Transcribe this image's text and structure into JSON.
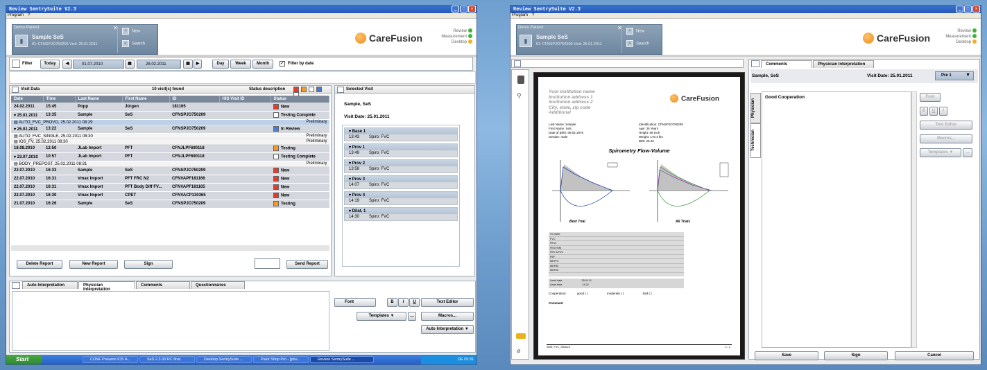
{
  "left_window": {
    "title": "Review SentrySuite V2.3",
    "menu": [
      "Program",
      "?"
    ],
    "patient": {
      "label": "Demo Patient",
      "name": "Sample SeS",
      "id_line": "ID: CFNSPJO750209 Visit: 25.01.2011",
      "new_label": "New",
      "search_label": "Search"
    },
    "brand": "CareFusion",
    "modes": [
      "Review",
      "Measurement",
      "Desktop"
    ],
    "filter": {
      "label": "Filter",
      "today": "Today",
      "from": "01.07.2010",
      "to": "28.02.2011",
      "day": "Day",
      "week": "Week",
      "month": "Month",
      "filter_by_date": "Filter by date"
    },
    "visit_data": {
      "title": "Visit Data",
      "found": "10 visit(s) found",
      "status_desc": "Status description",
      "columns": [
        "Date",
        "Time",
        "Last Name",
        "First Name",
        "ID",
        "HIS Visit ID",
        "Status"
      ],
      "rows": [
        {
          "date": "24.02.2011",
          "time": "15:45",
          "last": "Popp",
          "first": "Jürgen",
          "id": "181165",
          "status": "New",
          "st": "r"
        },
        {
          "date": "25.01.2011",
          "time": "13:35",
          "last": "Sample",
          "first": "SeS",
          "id": "CFNSPJO750209",
          "status": "Testing Complete",
          "st": "g",
          "exp": true
        },
        {
          "sub": "AUTO_FVC_PROVO, 25.02.2011 08:29",
          "right": "Preliminary",
          "sel": true
        },
        {
          "date": "25.01.2011",
          "time": "13:22",
          "last": "Sample",
          "first": "SeS",
          "id": "CFNSPJO750209",
          "status": "In Review",
          "st": "b",
          "exp": true
        },
        {
          "sub": "AUTO_FVC_SINGLE, 25.02.2011 08:30",
          "right": "Preliminary"
        },
        {
          "sub": "IOS_FV, 25.02.2011 08:30",
          "right": "Preliminary"
        },
        {
          "date": "18.08.2010",
          "time": "12:50",
          "last": "JLab Import",
          "first": "PFT",
          "id": "CFNJLPF690118",
          "status": "Testing",
          "st": "o"
        },
        {
          "date": "23.07.2010",
          "time": "10:57",
          "last": "JLab Import",
          "first": "PFT",
          "id": "CFNJLPF690118",
          "status": "Testing Complete",
          "st": "g",
          "exp": true
        },
        {
          "sub": "BODY_PREPOST, 25.02.2011 08:31",
          "right": "Preliminary"
        },
        {
          "date": "22.07.2010",
          "time": "16:33",
          "last": "Sample",
          "first": "SeS",
          "id": "CFNSPJO750209",
          "status": "New",
          "st": "r"
        },
        {
          "date": "22.07.2010",
          "time": "16:31",
          "last": "Vmax Import",
          "first": "PFT FRC N2",
          "id": "CFNVAPF181166",
          "status": "New",
          "st": "r"
        },
        {
          "date": "22.07.2010",
          "time": "16:31",
          "last": "Vmax Import",
          "first": "PFT Body Diff FV...",
          "id": "CFNVAPF181165",
          "status": "New",
          "st": "r"
        },
        {
          "date": "22.07.2010",
          "time": "16:30",
          "last": "Vmax Import",
          "first": "CPET",
          "id": "CFNVACP130365",
          "status": "New",
          "st": "r"
        },
        {
          "date": "21.07.2010",
          "time": "16:26",
          "last": "Sample",
          "first": "SeS",
          "id": "CFNSPJO750209",
          "status": "Testing",
          "st": "o"
        }
      ],
      "buttons": {
        "delete": "Delete Report",
        "new": "New Report",
        "sign": "Sign",
        "send": "Send Report"
      }
    },
    "selected_visit": {
      "title": "Selected Visit",
      "name": "Sample, SeS",
      "visit_date": "Visit Date: 25.01.2011",
      "groups": [
        {
          "h": "Base 1",
          "t": "13:43",
          "v": "Spiro: FVC"
        },
        {
          "h": "Prov 1",
          "t": "13:49",
          "v": "Spiro: FVC"
        },
        {
          "h": "Prov 2",
          "t": "13:58",
          "v": "Spiro: FVC"
        },
        {
          "h": "Prov 3",
          "t": "14:07",
          "v": "Spiro: FVC"
        },
        {
          "h": "Prov 4",
          "t": "14:19",
          "v": "Spiro: FVC"
        },
        {
          "h": "Dilat. 1",
          "t": "14:30",
          "v": "Spiro: FVC"
        }
      ]
    },
    "bottom_tabs": [
      "Auto Interpretation",
      "Physician Interpretation",
      "Comments",
      "Questionnaires"
    ],
    "right_tools": {
      "font": "Font",
      "bold": "B",
      "italic": "I",
      "underline": "U",
      "text_editor": "Text Editor",
      "templates": "Templates",
      "macros": "Macros...",
      "auto_interp": "Auto Interpretation"
    },
    "taskbar": {
      "start": "Start",
      "items": [
        "CONF Pneumo IOS A...",
        "SeS 2.3.93 RC final",
        "Desktop SentrySuite ...",
        "Paint Shop Pro - [phu...",
        "Review SentrySuite ..."
      ],
      "tray": "DE     09:31"
    }
  },
  "right_window": {
    "title": "Review SentrySuite V2.3",
    "menu": [
      "Program",
      "?"
    ],
    "patient": {
      "label": "Demo Patient",
      "name": "Sample SeS",
      "id_line": "ID: CFNSPJO750209 Visit: 25.01.2011",
      "new_label": "New",
      "search_label": "Search"
    },
    "brand": "CareFusion",
    "modes": [
      "Review",
      "Measurement",
      "Desktop"
    ],
    "report": {
      "inst": [
        "Your institution name",
        "Institution address 1",
        "Institution address 2",
        "City, state, zip code",
        "Additional"
      ],
      "brand": "CareFusion",
      "left_fields": [
        "Last Name:   Sample",
        "First Name:  SeS",
        "",
        "Date of Birth:  09.02.1975",
        "Gender:     male"
      ],
      "right_fields": [
        "Identification:  CFNSPJO750209",
        "Age:    35 Years",
        "Height:   69 Inch",
        "Weight:   176.4 lbs",
        "BMI:     26.42"
      ],
      "chart_title": "Spirometry Flow-Volume",
      "best": "Best Trial",
      "all": "All Trials",
      "cooperation": "Cooperation:",
      "good": "good ( )",
      "moderate": "moderate ( )",
      "bad": "bad ( )",
      "comment": "Comment",
      "footer_left": "SMR_FVC_SINGLE",
      "footer_right": "1 / 1",
      "level_date": "Level date",
      "level_date_val": "25.01.11",
      "level_time": "Level time",
      "level_time_val": "13:22",
      "table_rows": [
        "VC MAX",
        "FVC",
        "FEV1",
        "FEV1%M",
        "FEV 1/FVC",
        "PEF",
        "MEF75",
        "MEF50",
        "MEF25"
      ]
    },
    "comments": {
      "tabs": [
        "Comments",
        "Physician Interpretation"
      ],
      "name": "Sample, SeS",
      "visit_date": "Visit Date: 25.01.2011",
      "pre": "Pre 1",
      "side_tabs": [
        "Physician",
        "Technician"
      ],
      "text": "Good Cooperation",
      "font": "Font",
      "bold": "B",
      "underline": "U",
      "italic": "I",
      "text_editor": "Text Editor",
      "macros": "Macros...",
      "templates": "Templates",
      "save": "Save",
      "sign": "Sign",
      "cancel": "Cancel"
    }
  }
}
